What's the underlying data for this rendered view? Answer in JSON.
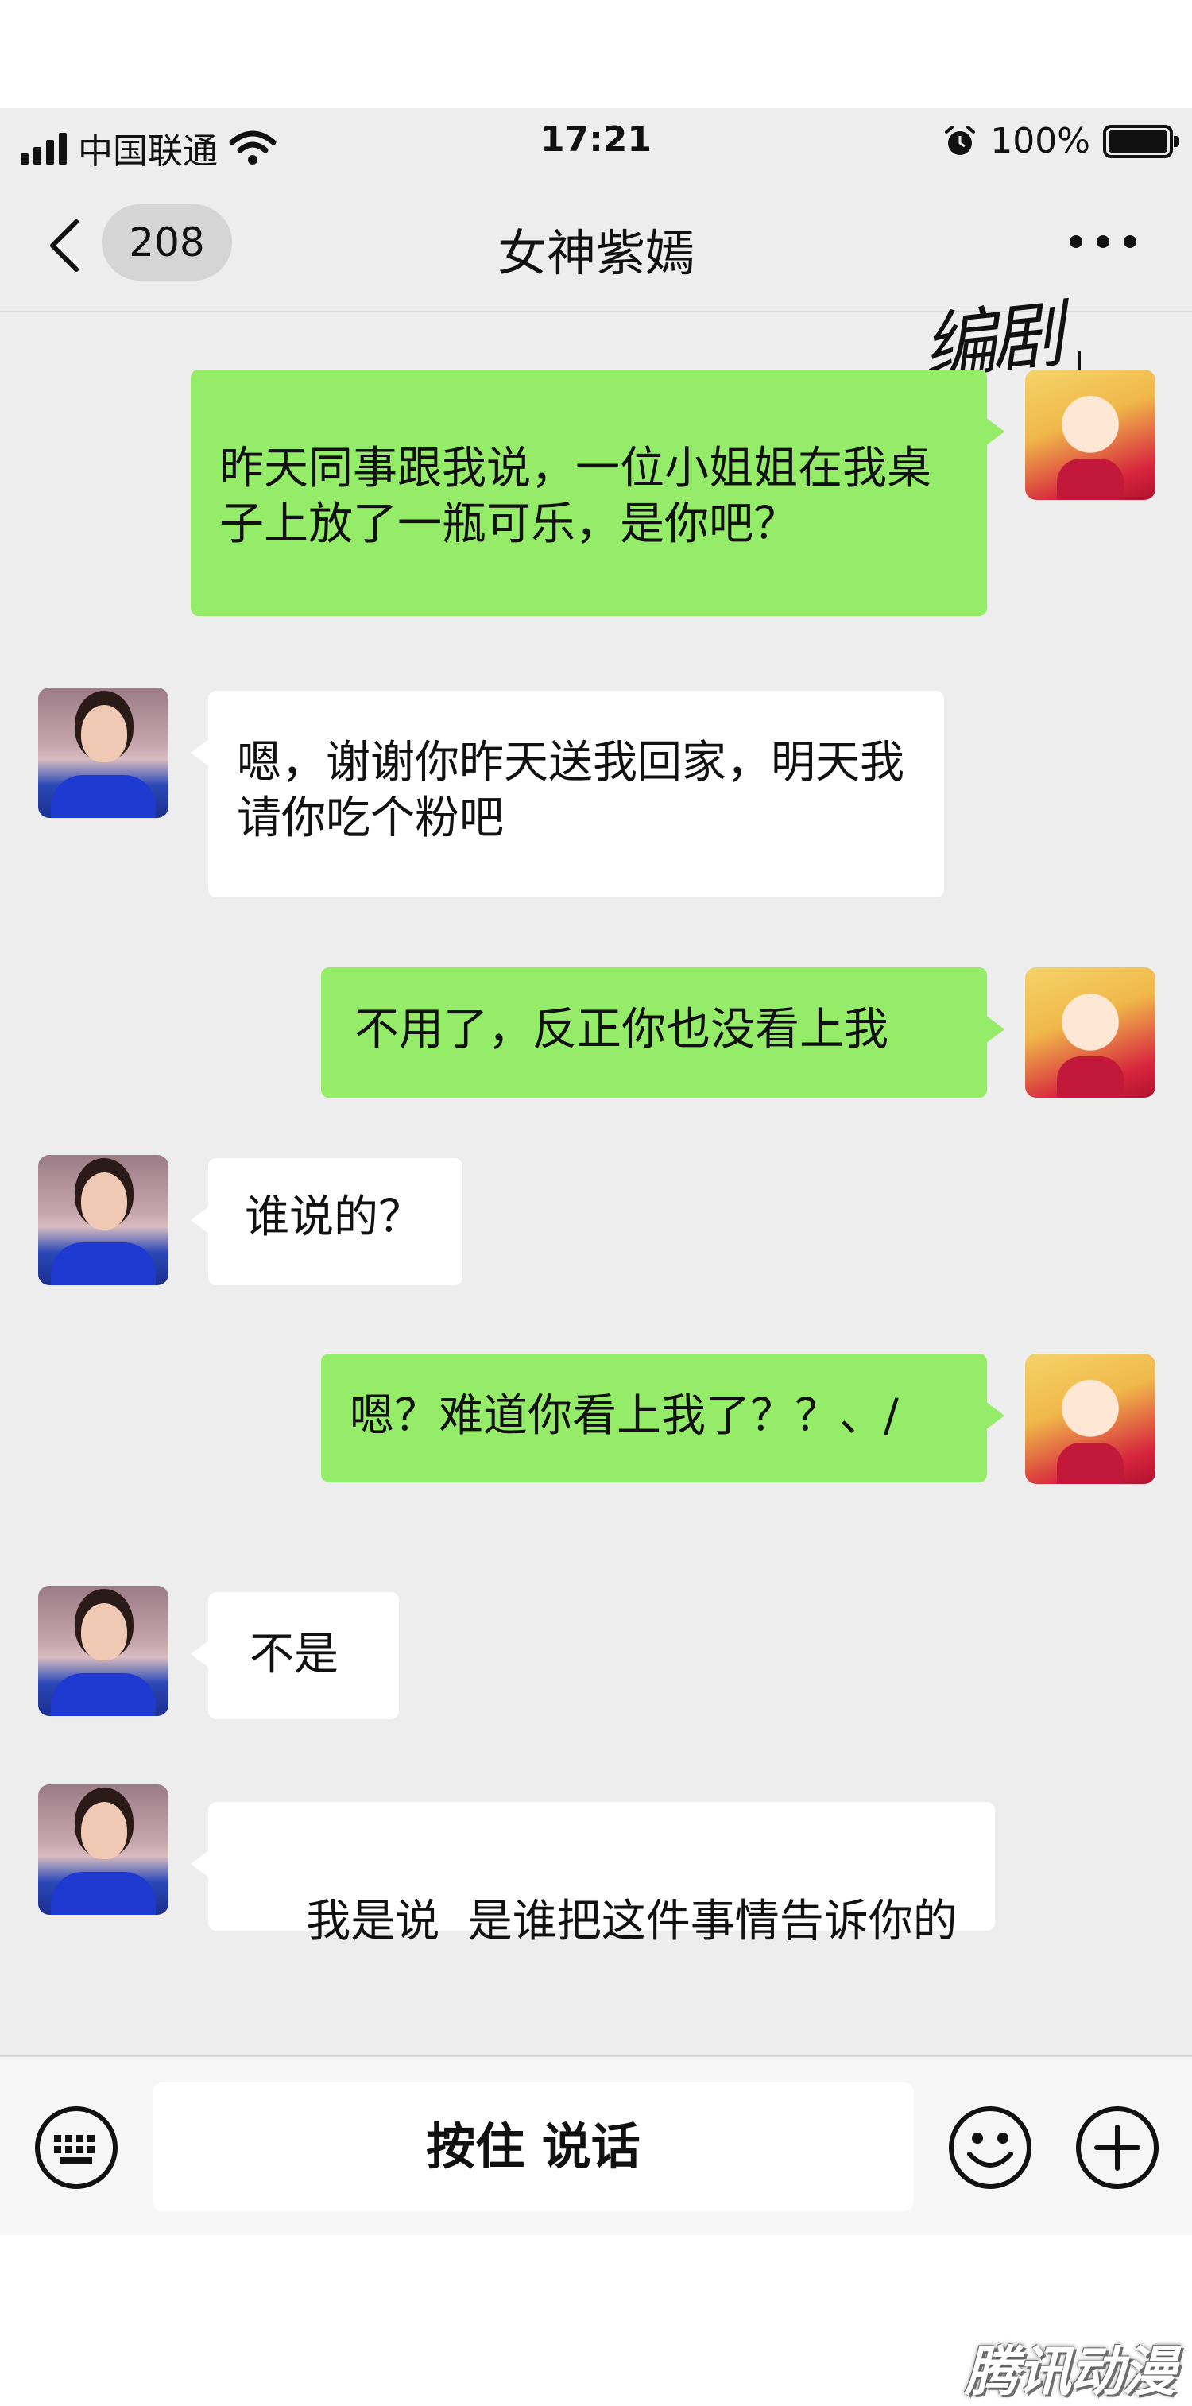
{
  "status_bar": {
    "carrier": "中国联通",
    "time": "17:21",
    "battery": "100%"
  },
  "nav": {
    "unread_count": "208",
    "title": "女神紫嫣"
  },
  "annotation": "编剧",
  "messages": [
    {
      "sender": "self",
      "text": "昨天同事跟我说，一位小姐姐在我桌子上放了一瓶可乐，是你吧？"
    },
    {
      "sender": "other",
      "text": "嗯，谢谢你昨天送我回家，明天我请你吃个粉吧"
    },
    {
      "sender": "self",
      "text": "不用了，反正你也没看上我"
    },
    {
      "sender": "other",
      "text": "谁说的？"
    },
    {
      "sender": "self",
      "text": "嗯？难道你看上我了？？、/"
    },
    {
      "sender": "other",
      "text": "不是"
    },
    {
      "sender": "other",
      "text": "我是说  是谁把这件事情告诉你的"
    }
  ],
  "input_bar": {
    "voice_label": "按住 说话"
  },
  "watermark": "腾讯动漫",
  "colors": {
    "self_bubble": "#95ec69",
    "other_bubble": "#ffffff",
    "chat_background": "#ededed"
  },
  "icons": [
    "back-arrow-icon",
    "more-icon",
    "keyboard-icon",
    "emoji-icon",
    "plus-icon",
    "wifi-icon",
    "alarm-icon",
    "battery-icon",
    "signal-icon"
  ]
}
